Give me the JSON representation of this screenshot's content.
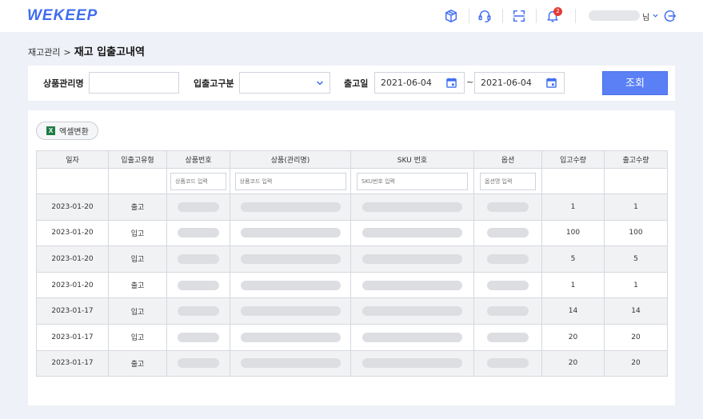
{
  "header": {
    "logo": "WEKEEP",
    "notification_count": "2",
    "user_suffix": "님",
    "icons": [
      "box-icon",
      "headset-icon",
      "scan-icon",
      "bell-icon",
      "logout-icon"
    ]
  },
  "breadcrumb": {
    "parent": "재고관리",
    "separator": ">",
    "current": "재고 입출고내역"
  },
  "filter": {
    "product_label": "상품관리명",
    "product_value": "",
    "type_label": "입출고구분",
    "type_value": "",
    "date_label": "출고일",
    "date_from": "2021-06-04",
    "date_sep": "~",
    "date_to": "2021-06-04",
    "search_label": "조회"
  },
  "toolbar": {
    "excel_label": "엑셀변환"
  },
  "table": {
    "columns": [
      "일자",
      "입출고유형",
      "상품번호",
      "상품(관리명)",
      "SKU 번호",
      "옵션",
      "입고수량",
      "출고수량"
    ],
    "filters": {
      "product_no": "상품코드 입력",
      "product_name": "상품코드 입력",
      "sku": "SKU번호 입력",
      "option": "옵션명 입력"
    },
    "rows": [
      {
        "date": "2023-01-20",
        "type": "출고",
        "in_qty": "1",
        "out_qty": "1"
      },
      {
        "date": "2023-01-20",
        "type": "입고",
        "in_qty": "100",
        "out_qty": "100"
      },
      {
        "date": "2023-01-20",
        "type": "입고",
        "in_qty": "5",
        "out_qty": "5"
      },
      {
        "date": "2023-01-20",
        "type": "출고",
        "in_qty": "1",
        "out_qty": "1"
      },
      {
        "date": "2023-01-17",
        "type": "입고",
        "in_qty": "14",
        "out_qty": "14"
      },
      {
        "date": "2023-01-17",
        "type": "입고",
        "in_qty": "20",
        "out_qty": "20"
      },
      {
        "date": "2023-01-17",
        "type": "출고",
        "in_qty": "20",
        "out_qty": "20"
      }
    ]
  },
  "colors": {
    "accent": "#3f6df0",
    "button": "#5b80f5",
    "badge": "#e53935",
    "excel": "#1e7d45"
  }
}
